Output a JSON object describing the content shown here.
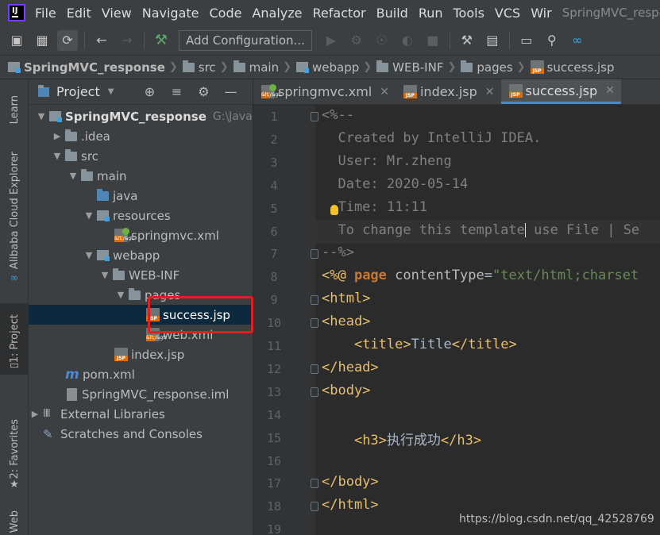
{
  "menubar": {
    "items": [
      "File",
      "Edit",
      "View",
      "Navigate",
      "Code",
      "Analyze",
      "Refactor",
      "Build",
      "Run",
      "Tools",
      "VCS",
      "Wir"
    ],
    "title_fragment": "SpringMVC_respo"
  },
  "toolbar": {
    "add_configuration": "Add Configuration..."
  },
  "breadcrumb": {
    "items": [
      "SpringMVC_response",
      "src",
      "main",
      "webapp",
      "WEB-INF",
      "pages",
      "success.jsp"
    ]
  },
  "left_stripe": {
    "learn": "Learn",
    "alibaba": "Alibaba Cloud Explorer",
    "project": "1: Project",
    "favorites": "2: Favorites",
    "web": "Web"
  },
  "project_panel": {
    "title": "Project",
    "tree": [
      {
        "label": "SpringMVC_response",
        "path": "G:\\JavaEE",
        "icon": "module-folder-icon",
        "toggle": "open",
        "selected": false
      },
      {
        "label": ".idea",
        "icon": "folder-icon",
        "toggle": "closed",
        "selected": false
      },
      {
        "label": "src",
        "icon": "folder-icon",
        "toggle": "open",
        "selected": false
      },
      {
        "label": "main",
        "icon": "folder-icon",
        "toggle": "open",
        "selected": false
      },
      {
        "label": "java",
        "icon": "source-folder-icon",
        "toggle": "none",
        "selected": false
      },
      {
        "label": "resources",
        "icon": "resources-folder-icon",
        "toggle": "open",
        "selected": false
      },
      {
        "label": "springmvc.xml",
        "icon": "spring-xml-icon",
        "toggle": "none",
        "selected": false
      },
      {
        "label": "webapp",
        "icon": "web-folder-icon",
        "toggle": "open",
        "selected": false
      },
      {
        "label": "WEB-INF",
        "icon": "folder-icon",
        "toggle": "open",
        "selected": false
      },
      {
        "label": "pages",
        "icon": "folder-icon",
        "toggle": "open",
        "selected": false
      },
      {
        "label": "success.jsp",
        "icon": "jsp-file-icon",
        "toggle": "none",
        "selected": true
      },
      {
        "label": "web.xml",
        "icon": "xml-file-icon",
        "toggle": "none",
        "selected": false
      },
      {
        "label": "index.jsp",
        "icon": "jsp-file-icon",
        "toggle": "none",
        "selected": false
      },
      {
        "label": "pom.xml",
        "icon": "maven-icon",
        "toggle": "none",
        "selected": false
      },
      {
        "label": "SpringMVC_response.iml",
        "icon": "iml-file-icon",
        "toggle": "none",
        "selected": false
      },
      {
        "label": "External Libraries",
        "icon": "libraries-icon",
        "toggle": "closed",
        "selected": false
      },
      {
        "label": "Scratches and Consoles",
        "icon": "scratches-icon",
        "toggle": "none",
        "selected": false
      }
    ]
  },
  "editor": {
    "tabs": [
      {
        "label": "springmvc.xml",
        "icon": "spring-xml-icon",
        "active": false
      },
      {
        "label": "index.jsp",
        "icon": "jsp-file-icon",
        "active": false
      },
      {
        "label": "success.jsp",
        "icon": "jsp-file-icon",
        "active": true
      }
    ],
    "current_line": 6,
    "lines": [
      [
        [
          "c-com",
          "<%--"
        ]
      ],
      [
        [
          "c-com",
          "  Created by IntelliJ IDEA."
        ]
      ],
      [
        [
          "c-com",
          "  User: Mr.zheng"
        ]
      ],
      [
        [
          "c-com",
          "  Date: 2020-05-14"
        ]
      ],
      [
        [
          "c-com",
          "  Time: 11:11"
        ]
      ],
      [
        [
          "c-com",
          "  To change this template"
        ],
        [
          "caret",
          ""
        ],
        [
          "c-com",
          " use File | Se"
        ]
      ],
      [
        [
          "c-com",
          "--%>"
        ]
      ],
      [
        [
          "c-tag",
          "<%@ "
        ],
        [
          "c-kw",
          "page "
        ],
        [
          "c-attr",
          "contentType"
        ],
        [
          "",
          "="
        ],
        [
          "c-str",
          "\"text/html;charset"
        ]
      ],
      [
        [
          "c-tag",
          "<html>"
        ]
      ],
      [
        [
          "c-tag",
          "<head>"
        ]
      ],
      [
        [
          "",
          "    "
        ],
        [
          "c-tag",
          "<title>"
        ],
        [
          "",
          "Title"
        ],
        [
          "c-tag",
          "</title>"
        ]
      ],
      [
        [
          "c-tag",
          "</head>"
        ]
      ],
      [
        [
          "c-tag",
          "<body>"
        ]
      ],
      [
        [
          "",
          ""
        ]
      ],
      [
        [
          "",
          "    "
        ],
        [
          "c-tag",
          "<h3>"
        ],
        [
          "",
          "执行成功"
        ],
        [
          "c-tag",
          "</h3>"
        ]
      ],
      [
        [
          "",
          ""
        ]
      ],
      [
        [
          "c-tag",
          "</body>"
        ]
      ],
      [
        [
          "c-tag",
          "</html>"
        ]
      ],
      [
        [
          "",
          ""
        ]
      ]
    ]
  },
  "watermark": "https://blog.csdn.net/qq_42528769"
}
